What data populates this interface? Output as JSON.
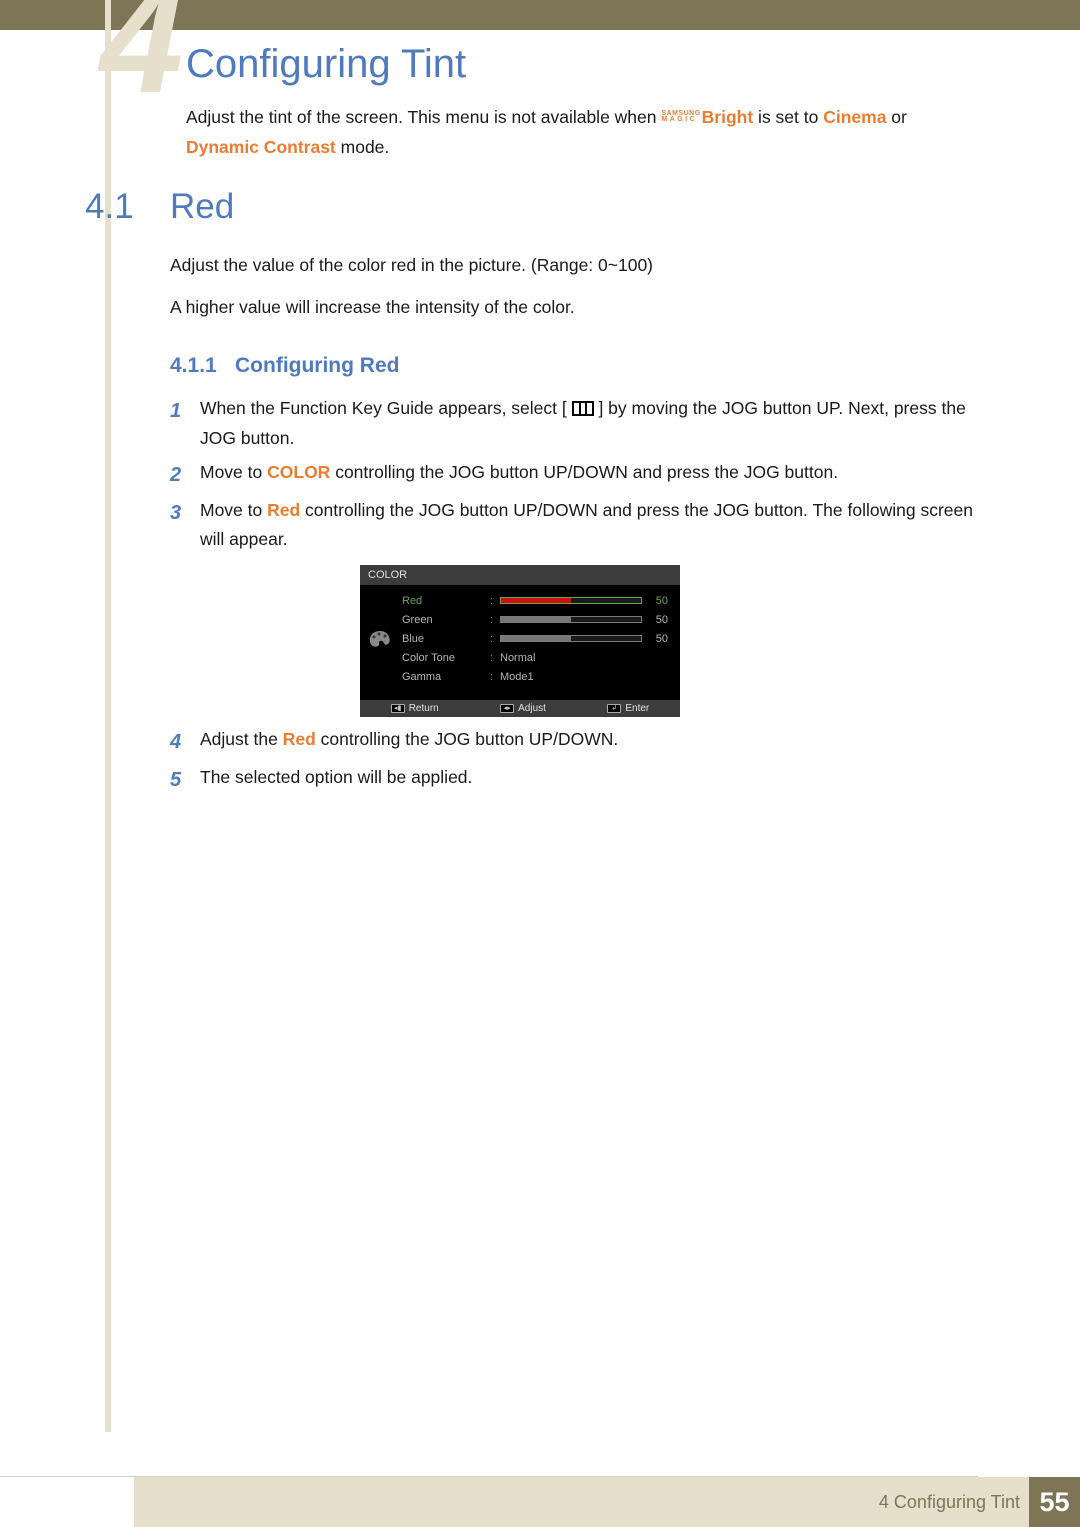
{
  "chapter_bg_number": "4",
  "page_title": "Configuring Tint",
  "intro_part1": "Adjust the tint of the screen. This menu is not available when ",
  "intro_magic_top": "SAMSUNG",
  "intro_magic_bottom": "MAGIC",
  "intro_bright": "Bright",
  "intro_part2": " is set to ",
  "intro_cinema": "Cinema",
  "intro_part3": " or ",
  "intro_dynamic": "Dynamic Contrast",
  "intro_part4": " mode.",
  "section_number": "4.1",
  "section_title": "Red",
  "para1": "Adjust the value of the color red in the picture. (Range: 0~100)",
  "para2": "A higher value will increase the intensity of the color.",
  "subsection_number": "4.1.1",
  "subsection_title": "Configuring Red",
  "steps": [
    {
      "num": "1",
      "pre": "When the Function Key Guide appears, select  [ ",
      "post": " ]  by moving the JOG button UP. Next, press the JOG button.",
      "has_icon": true
    },
    {
      "num": "2",
      "pre": "Move to ",
      "bold": "COLOR",
      "post": " controlling the JOG button UP/DOWN and press the JOG button."
    },
    {
      "num": "3",
      "pre": "Move to ",
      "bold": "Red",
      "post": " controlling the JOG button UP/DOWN and press the JOG button. The following screen will appear.",
      "has_osd_after": true
    },
    {
      "num": "4",
      "pre": "Adjust the ",
      "bold": "Red",
      "post": " controlling the JOG button UP/DOWN."
    },
    {
      "num": "5",
      "pre": "The selected option will be applied.",
      "bold": "",
      "post": ""
    }
  ],
  "osd": {
    "header": "COLOR",
    "rows": [
      {
        "label": "Red",
        "selected": true,
        "type": "slider",
        "fill": "red",
        "value": "50"
      },
      {
        "label": "Green",
        "selected": false,
        "type": "slider",
        "fill": "grey",
        "value": "50"
      },
      {
        "label": "Blue",
        "selected": false,
        "type": "slider",
        "fill": "grey",
        "value": "50"
      },
      {
        "label": "Color Tone",
        "selected": false,
        "type": "text",
        "value": "Normal"
      },
      {
        "label": "Gamma",
        "selected": false,
        "type": "text",
        "value": "Mode1"
      }
    ],
    "footer": [
      {
        "icon": "◂▮",
        "label": "Return"
      },
      {
        "icon": "◂▸",
        "label": "Adjust"
      },
      {
        "icon": "↲",
        "label": "Enter"
      }
    ]
  },
  "footer_chapter": "4 Configuring Tint",
  "footer_page": "55"
}
